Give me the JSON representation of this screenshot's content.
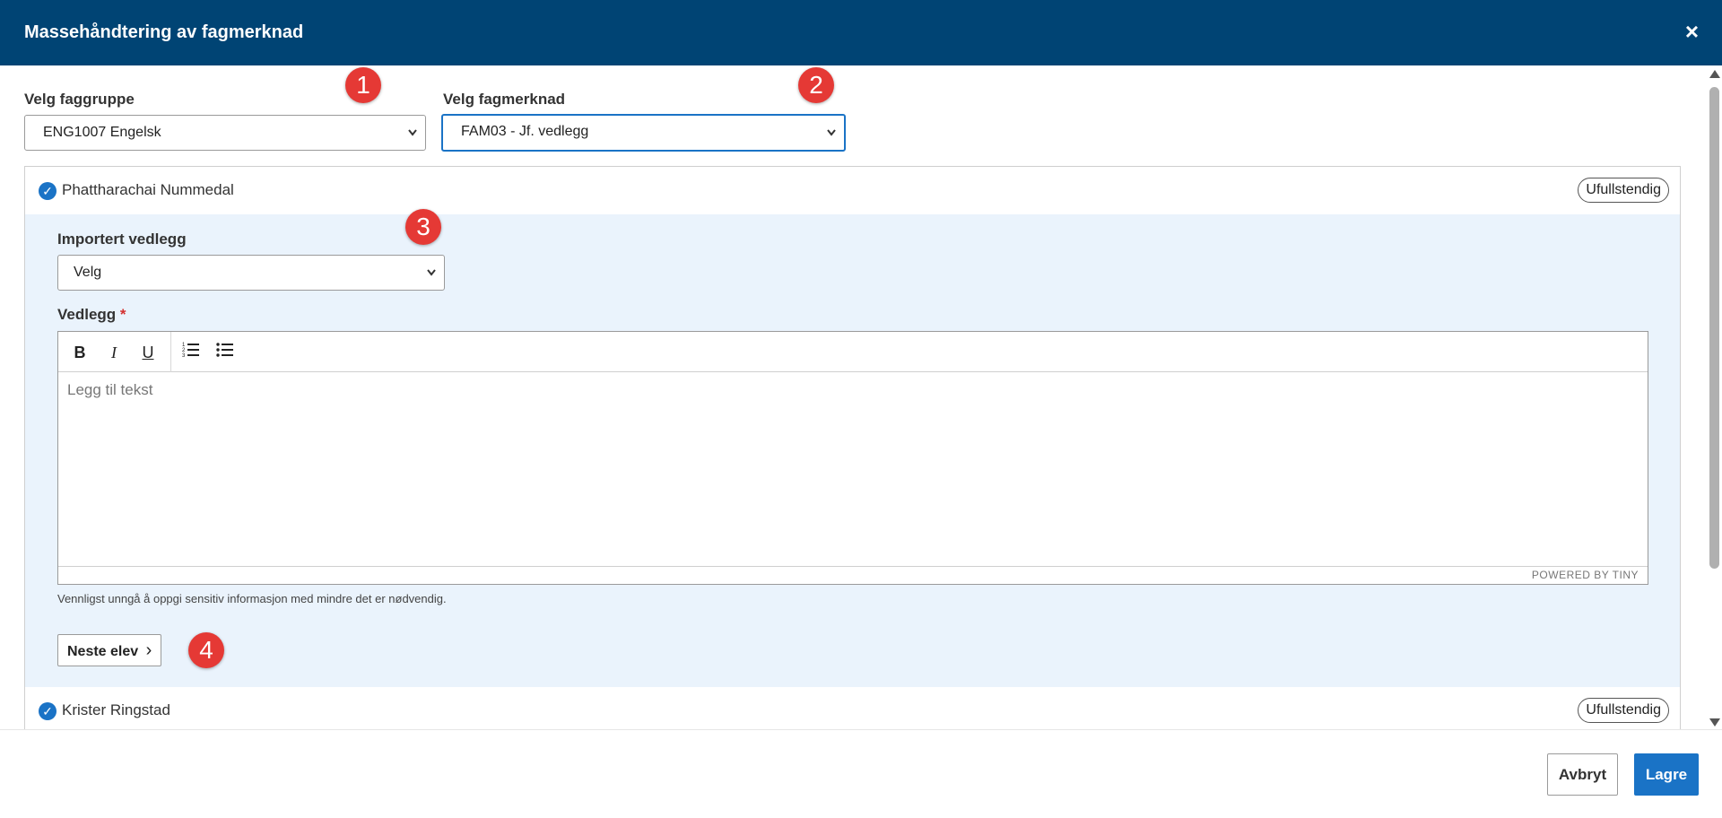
{
  "dialog": {
    "title": "Massehåndtering av fagmerknad",
    "close_glyph": "×"
  },
  "filters": {
    "subject_group": {
      "label": "Velg faggruppe",
      "value": "ENG1007 Engelsk"
    },
    "remark": {
      "label": "Velg fagmerknad",
      "value": "FAM03 - Jf. vedlegg"
    }
  },
  "annotations": [
    "1",
    "2",
    "3",
    "4"
  ],
  "students": [
    {
      "name": "Phattharachai Nummedal",
      "status": "Ufullstendig",
      "checked": true
    },
    {
      "name": "Krister Ringstad",
      "status": "Ufullstendig",
      "checked": true
    }
  ],
  "panel": {
    "imported_attachment_label": "Importert vedlegg",
    "imported_attachment_value": "Velg",
    "attachment_label": "Vedlegg",
    "required_marker": "*",
    "editor_placeholder": "Legg til tekst",
    "editor_footer": "POWERED BY TINY",
    "toolbar": {
      "bold": "B",
      "italic": "I",
      "underline": "U"
    },
    "hint": "Vennligst unngå å oppgi sensitiv informasjon med mindre det er nødvendig.",
    "next_button": "Neste elev",
    "next_chevron": "›"
  },
  "footer": {
    "cancel": "Avbryt",
    "save": "Lagre"
  },
  "colors": {
    "header": "#004474",
    "primary": "#1a73c6",
    "panel_bg": "#eaf3fc",
    "annotation": "#e53935"
  }
}
